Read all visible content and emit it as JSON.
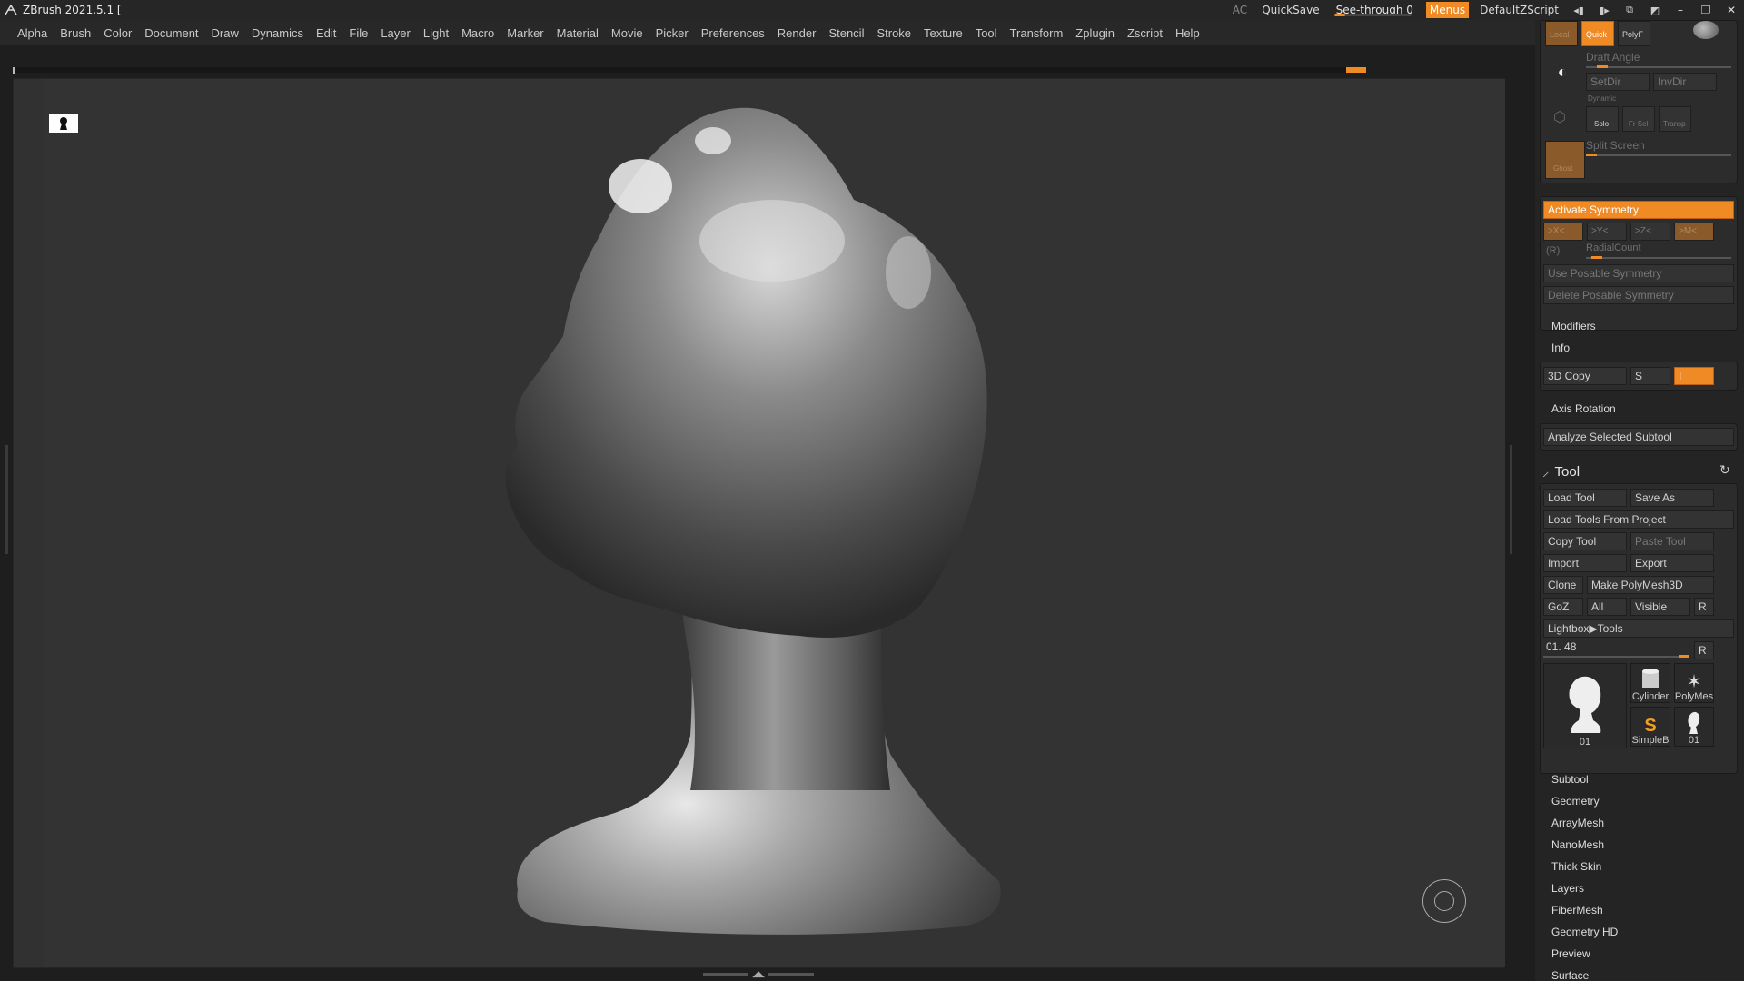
{
  "window": {
    "title": "ZBrush 2021.5.1 [",
    "ac": "AC",
    "quicksave": "QuickSave",
    "see_through_label": "See-through",
    "see_through_value": "0",
    "menus": "Menus",
    "default_zscript": "DefaultZScript"
  },
  "menubar": [
    "Alpha",
    "Brush",
    "Color",
    "Document",
    "Draw",
    "Dynamics",
    "Edit",
    "File",
    "Layer",
    "Light",
    "Macro",
    "Marker",
    "Material",
    "Movie",
    "Picker",
    "Preferences",
    "Render",
    "Stencil",
    "Stroke",
    "Texture",
    "Tool",
    "Transform",
    "Zplugin",
    "Zscript",
    "Help"
  ],
  "panel": {
    "top_buttons": [
      "Local",
      "Quick",
      "PolyF"
    ],
    "draft_angle": "Draft Angle",
    "setdir": "SetDir",
    "invdir": "InvDir",
    "dynamic": "Dynamic",
    "solo": "Solo",
    "frsel": "Fr Sel",
    "transp": "Transp",
    "ghost": "Ghost",
    "split_screen": "Split Screen",
    "activate_symmetry": "Activate Symmetry",
    "axes": [
      ">X<",
      ">Y<",
      ">Z<",
      ">M<"
    ],
    "r": "(R)",
    "radial_count": "RadialCount",
    "use_posable": "Use Posable Symmetry",
    "delete_posable": "Delete Posable Symmetry",
    "modifiers": "Modifiers",
    "info": "Info",
    "copy3d": "3D Copy",
    "copy_s": "S",
    "copy_i": "I",
    "axis_rotation": "Axis Rotation",
    "analyze": "Analyze Selected Subtool",
    "tool": "Tool",
    "load_tool": "Load Tool",
    "save_as": "Save As",
    "load_tools_project": "Load Tools From Project",
    "copy_tool": "Copy Tool",
    "paste_tool": "Paste Tool",
    "import": "Import",
    "export": "Export",
    "clone": "Clone",
    "make_polymesh": "Make PolyMesh3D",
    "goz": "GoZ",
    "all": "All",
    "visible": "Visible",
    "r_btn": "R",
    "lightbox_tools": "Lightbox▶Tools",
    "tool_slider": "01. 48",
    "thumbs": [
      "01",
      "Cylinder",
      "PolyMes",
      "SimpleB",
      "01"
    ],
    "subpalettes": [
      "Subtool",
      "Geometry",
      "ArrayMesh",
      "NanoMesh",
      "Thick Skin",
      "Layers",
      "FiberMesh",
      "Geometry HD",
      "Preview",
      "Surface"
    ]
  }
}
